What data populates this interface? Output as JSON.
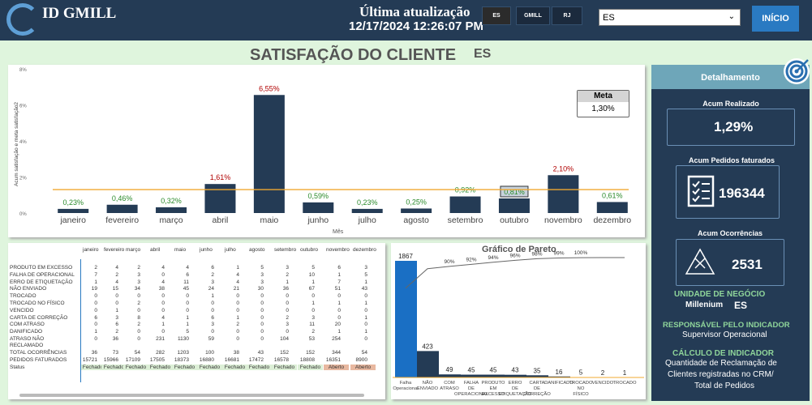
{
  "header": {
    "brand": "ID GMILL",
    "update_label": "Última atualização",
    "update_time": "12/17/2024 12:26:07 PM",
    "segments": [
      "ES",
      "GMILL",
      "RJ"
    ],
    "select_value": "ES",
    "home_button": "INÍCIO"
  },
  "page": {
    "title": "SATISFAÇÃO DO CLIENTE",
    "title_tag": "ES"
  },
  "chart_data": {
    "type": "bar",
    "ylabel": "Acum satisfação e meta satisfação2",
    "xlabel": "Mês",
    "yticks": [
      "8%",
      "6%",
      "4%",
      "2%",
      "0%"
    ],
    "ylim": [
      0,
      8
    ],
    "categories": [
      "janeiro",
      "fevereiro",
      "março",
      "abril",
      "maio",
      "junho",
      "julho",
      "agosto",
      "setembro",
      "outubro",
      "novembro",
      "dezembro"
    ],
    "values": [
      0.23,
      0.46,
      0.32,
      1.61,
      6.55,
      0.59,
      0.23,
      0.25,
      0.92,
      0.81,
      2.1,
      0.61
    ],
    "labels": [
      "0,23%",
      "0,46%",
      "0,32%",
      "1,61%",
      "6,55%",
      "0,59%",
      "0,23%",
      "0,25%",
      "0,92%",
      "0,81%",
      "2,10%",
      "0,61%"
    ],
    "meta": {
      "label": "Meta",
      "value_text": "1,30%",
      "value": 1.3
    },
    "colors": {
      "bar": "#243b55",
      "meta_line": "#f0a830",
      "above": "#b00000",
      "below": "#2a8a2a"
    }
  },
  "table": {
    "months": [
      "janeiro",
      "fevereiro",
      "março",
      "abril",
      "maio",
      "junho",
      "julho",
      "agosto",
      "setembro",
      "outubro",
      "novembro",
      "dezembro"
    ],
    "rows": [
      {
        "label": "PRODUTO EM EXCESSO",
        "vals": [
          "2",
          "4",
          "2",
          "4",
          "4",
          "6",
          "1",
          "5",
          "3",
          "5",
          "6",
          "3"
        ]
      },
      {
        "label": "FALHA DE OPERACIONAL",
        "vals": [
          "7",
          "2",
          "3",
          "0",
          "6",
          "2",
          "4",
          "3",
          "2",
          "10",
          "1",
          "5"
        ]
      },
      {
        "label": "ERRO DE ETIQUETAÇÃO",
        "vals": [
          "1",
          "4",
          "3",
          "4",
          "11",
          "3",
          "4",
          "3",
          "1",
          "1",
          "7",
          "1"
        ]
      },
      {
        "label": "NÃO ENVIADO",
        "vals": [
          "19",
          "15",
          "34",
          "38",
          "45",
          "24",
          "21",
          "30",
          "36",
          "67",
          "51",
          "43"
        ]
      },
      {
        "label": "TROCADO",
        "vals": [
          "0",
          "0",
          "0",
          "0",
          "0",
          "1",
          "0",
          "0",
          "0",
          "0",
          "0",
          "0"
        ]
      },
      {
        "label": "TROCADO NO FÍSICO",
        "vals": [
          "0",
          "0",
          "2",
          "0",
          "0",
          "0",
          "0",
          "0",
          "0",
          "1",
          "1",
          "1"
        ]
      },
      {
        "label": "VENCIDO",
        "vals": [
          "0",
          "1",
          "0",
          "0",
          "0",
          "0",
          "0",
          "0",
          "0",
          "0",
          "0",
          "0"
        ]
      },
      {
        "label": "CARTA DE CORREÇÃO",
        "vals": [
          "6",
          "3",
          "8",
          "4",
          "1",
          "6",
          "1",
          "0",
          "2",
          "3",
          "0",
          "1"
        ]
      },
      {
        "label": "COM ATRASO",
        "vals": [
          "0",
          "6",
          "2",
          "1",
          "1",
          "3",
          "2",
          "0",
          "3",
          "11",
          "20",
          "0"
        ]
      },
      {
        "label": "DANIFICADO",
        "vals": [
          "1",
          "2",
          "0",
          "0",
          "5",
          "0",
          "0",
          "0",
          "0",
          "2",
          "1",
          "1"
        ]
      },
      {
        "label": "ATRASO NÃO RECLAMADO",
        "vals": [
          "0",
          "36",
          "0",
          "231",
          "1130",
          "59",
          "0",
          "0",
          "104",
          "53",
          "254",
          "0"
        ]
      },
      {
        "label": "TOTAL OCORRÊNCIAS",
        "vals": [
          "36",
          "73",
          "54",
          "282",
          "1203",
          "100",
          "38",
          "43",
          "152",
          "152",
          "344",
          "54"
        ]
      },
      {
        "label": "PEDIDOS FATURADOS",
        "vals": [
          "15721",
          "15966",
          "17109",
          "17505",
          "18373",
          "16880",
          "16681",
          "17472",
          "16578",
          "18808",
          "16351",
          "8900"
        ]
      },
      {
        "label": "Status",
        "vals": [
          "Fechado",
          "Fechado",
          "Fechado",
          "Fechado",
          "Fechado",
          "Fechado",
          "Fechado",
          "Fechado",
          "Fechado",
          "Fechado",
          "Aberto",
          "Aberto"
        ]
      }
    ]
  },
  "pareto": {
    "title": "Gráfico de Pareto",
    "categories": [
      "Falha Operacional",
      "NÃO ENVIADO",
      "COM ATRASO",
      "FALHA DE OPERACIONAL",
      "PRODUTO EM EXCESSO",
      "ERRO DE ETIQUETAÇÃO",
      "CARTA DE CORREÇÃO",
      "DANIFICADO",
      "TROCADO NO FÍSICO",
      "VENCIDO",
      "TROCADO"
    ],
    "values": [
      1867,
      423,
      49,
      45,
      45,
      43,
      35,
      16,
      5,
      2,
      1
    ],
    "cum_labels": [
      "",
      "",
      "90%",
      "92%",
      "94%",
      "96%",
      "98%",
      "99%",
      "100%"
    ],
    "colors": {
      "first": "#1a6fc4",
      "bars": "#243b55",
      "line": "#666666"
    }
  },
  "side": {
    "header": "Detalhamento",
    "acum_realizado_label": "Acum Realizado",
    "acum_realizado": "1,29%",
    "acum_pedidos_label": "Acum Pedidos faturados",
    "acum_pedidos": "196344",
    "acum_ocorrencias_label": "Acum Ocorrências",
    "acum_ocorrencias": "2531",
    "unidade_label": "UNIDADE DE NEGÓCIO",
    "unidade_value": "Millenium",
    "unidade_tag": "ES",
    "responsavel_label": "RESPONSÁVEL PELO INDICADOR",
    "responsavel_value": "Supervisor Operacional",
    "calculo_label": "CÁLCULO DE INDICADOR",
    "calculo_l1": "Quantidade de Reclamação de",
    "calculo_l2": "Clientes registradas no CRM/",
    "calculo_l3": "Total de Pedidos"
  }
}
